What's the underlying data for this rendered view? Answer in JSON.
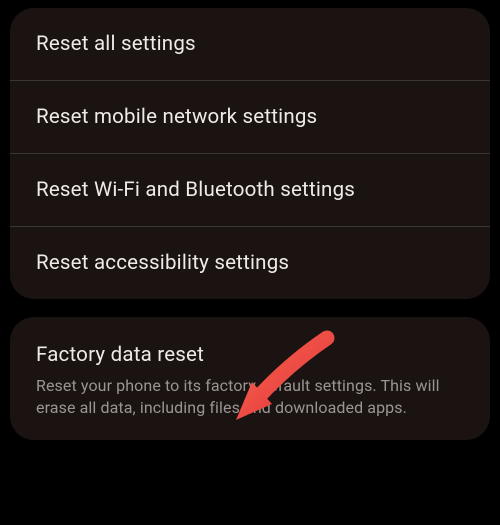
{
  "reset_options": {
    "items": [
      {
        "label": "Reset all settings"
      },
      {
        "label": "Reset mobile network settings"
      },
      {
        "label": "Reset Wi-Fi and Bluetooth settings"
      },
      {
        "label": "Reset accessibility settings"
      }
    ]
  },
  "factory_reset": {
    "title": "Factory data reset",
    "description": "Reset your phone to its factory default settings. This will erase all data, including files and downloaded apps."
  }
}
